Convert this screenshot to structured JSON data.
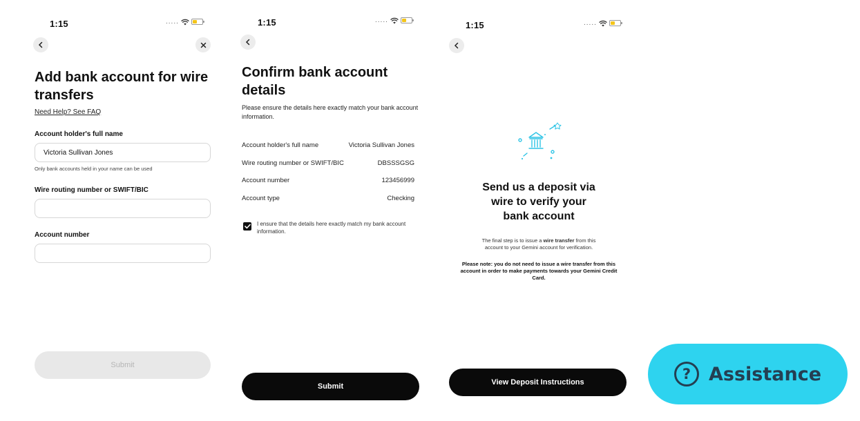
{
  "status": {
    "time": "1:15",
    "dots": "....."
  },
  "screen1": {
    "title": "Add bank account for wire transfers",
    "help_link": "Need Help? See FAQ",
    "holder_label": "Account holder's full name",
    "holder_value": "Victoria Sullivan Jones",
    "holder_hint": "Only bank accounts held in your name can be used",
    "routing_label": "Wire routing number or SWIFT/BIC",
    "routing_value": "",
    "account_label": "Account number",
    "account_value": "",
    "submit_label": "Submit",
    "back_icon": "chevron-left-icon",
    "close_icon": "close-icon"
  },
  "screen2": {
    "title": "Confirm bank account details",
    "description": "Please ensure the details here exactly match your bank account information.",
    "rows": [
      {
        "label": "Account holder's full name",
        "value": "Victoria Sullivan Jones"
      },
      {
        "label": "Wire routing number or SWIFT/BIC",
        "value": "DBSSSGSG"
      },
      {
        "label": "Account number",
        "value": "123456999"
      },
      {
        "label": "Account type",
        "value": "Checking"
      }
    ],
    "confirm_text": "I ensure that the details here exactly match my bank account information.",
    "confirm_checked": true,
    "submit_label": "Submit"
  },
  "screen3": {
    "title": "Send us a deposit via wire to verify your bank account",
    "body_pre": "The final step is to issue a ",
    "body_bold": "wire transfer",
    "body_post": " from this account to your Gemini account for verification.",
    "note": "Please note: you do not need to issue a wire transfer from this account in order to make payments towards your Gemini Credit Card.",
    "button_label": "View Deposit Instructions",
    "illustration_icon": "bank-icon",
    "accent_color": "#2ec4e6"
  },
  "assistance": {
    "label": "Assistance",
    "icon": "question-circle-icon",
    "bg_color": "#2ed3ef"
  }
}
